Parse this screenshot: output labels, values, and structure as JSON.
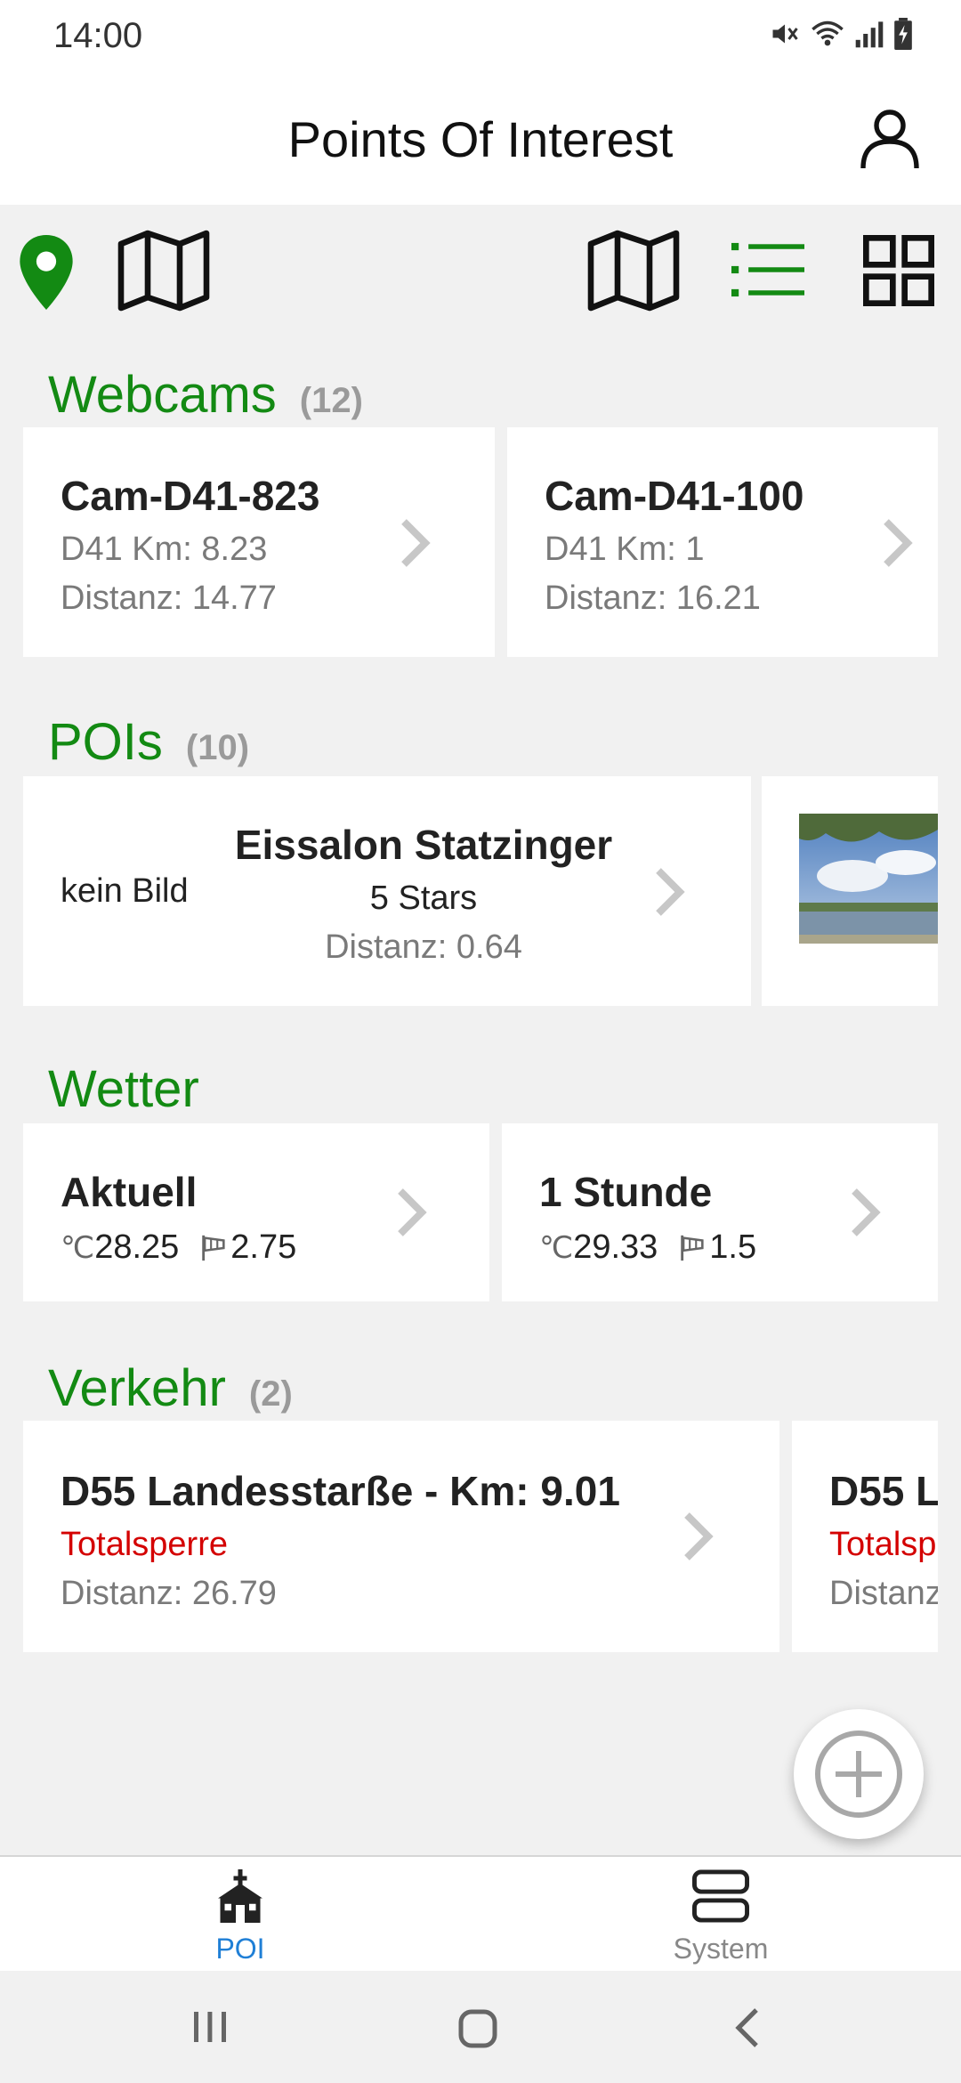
{
  "status": {
    "time": "14:00",
    "icons": [
      "mute-icon",
      "wifi-icon",
      "signal-icon",
      "battery-charging-icon"
    ]
  },
  "header": {
    "title": "Points Of Interest",
    "user_icon": "user-icon"
  },
  "toolbar": {
    "icons": [
      "location-pin-icon",
      "map-icon",
      "map-view-icon",
      "list-view-icon",
      "grid-view-icon"
    ],
    "accent": "#138a13"
  },
  "webcams": {
    "title": "Webcams",
    "count": "(12)",
    "items": [
      {
        "title": "Cam-D41-823",
        "km": "D41 Km: 8.23",
        "distance": "Distanz: 14.77"
      },
      {
        "title": "Cam-D41-100",
        "km": "D41 Km: 1",
        "distance": "Distanz: 16.21"
      }
    ]
  },
  "pois": {
    "title": "POIs",
    "count": "(10)",
    "items": [
      {
        "image_text": "kein Bild",
        "title": "Eissalon Statzinger",
        "rating": "5 Stars",
        "distance": "Distanz: 0.64"
      }
    ]
  },
  "wetter": {
    "title": "Wetter",
    "items": [
      {
        "title": "Aktuell",
        "temp": "28.25",
        "wind": "2.75"
      },
      {
        "title": "1 Stunde",
        "temp": "29.33",
        "wind": "1.5"
      }
    ],
    "temp_unit": "℃"
  },
  "verkehr": {
    "title": "Verkehr",
    "count": "(2)",
    "items": [
      {
        "title": "D55 Landesstarße - Km: 9.01",
        "status": "Totalsperre",
        "distance": "Distanz: 26.79"
      },
      {
        "title": "D55 L",
        "status": "Totalsp",
        "distance": "Distanz"
      }
    ]
  },
  "nav": {
    "items": [
      {
        "label": "POI",
        "icon": "church-icon",
        "active": true
      },
      {
        "label": "System",
        "icon": "server-icon",
        "active": false
      }
    ],
    "active_color": "#1f7fd6"
  },
  "colors": {
    "accent": "#138a13",
    "alert": "#d40000"
  }
}
